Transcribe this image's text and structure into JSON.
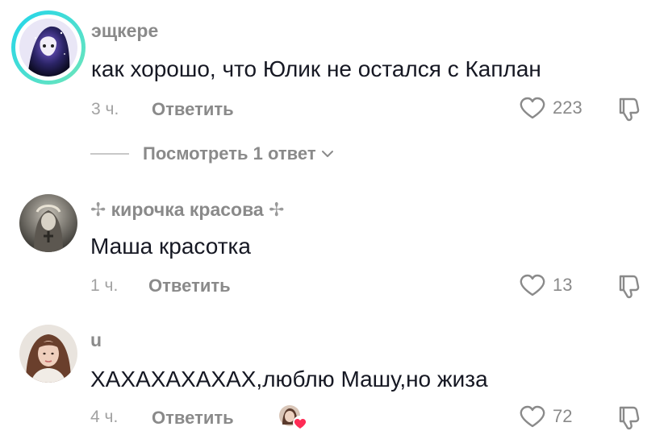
{
  "comments": [
    {
      "username": "эщкере",
      "text": "как хорошо, что Юлик не остался с Каплан",
      "time": "3 ч.",
      "reply_label": "Ответить",
      "likes": "223",
      "view_replies": "Посмотреть 1 ответ"
    },
    {
      "username": "кирочка красова",
      "username_decor": "✢",
      "text": "Маша красотка",
      "time": "1 ч.",
      "reply_label": "Ответить",
      "likes": "13"
    },
    {
      "username": "u",
      "text": "ХАХАХАХАХАХ,люблю Машу,но жиза",
      "time": "4 ч.",
      "reply_label": "Ответить",
      "likes": "72",
      "liked_by_creator": true
    }
  ],
  "icons": {
    "like": "heart-outline-icon",
    "dislike": "thumbs-down-icon",
    "expand": "chevron-down-icon",
    "creator_like": "creator-heart-badge-icon"
  },
  "colors": {
    "username": "#8a8a8a",
    "text": "#161823",
    "meta": "#a2a2a2",
    "story_ring_start": "#20d5ec",
    "story_ring_end": "#6fe6b9",
    "heart_badge": "#fe2c55"
  }
}
